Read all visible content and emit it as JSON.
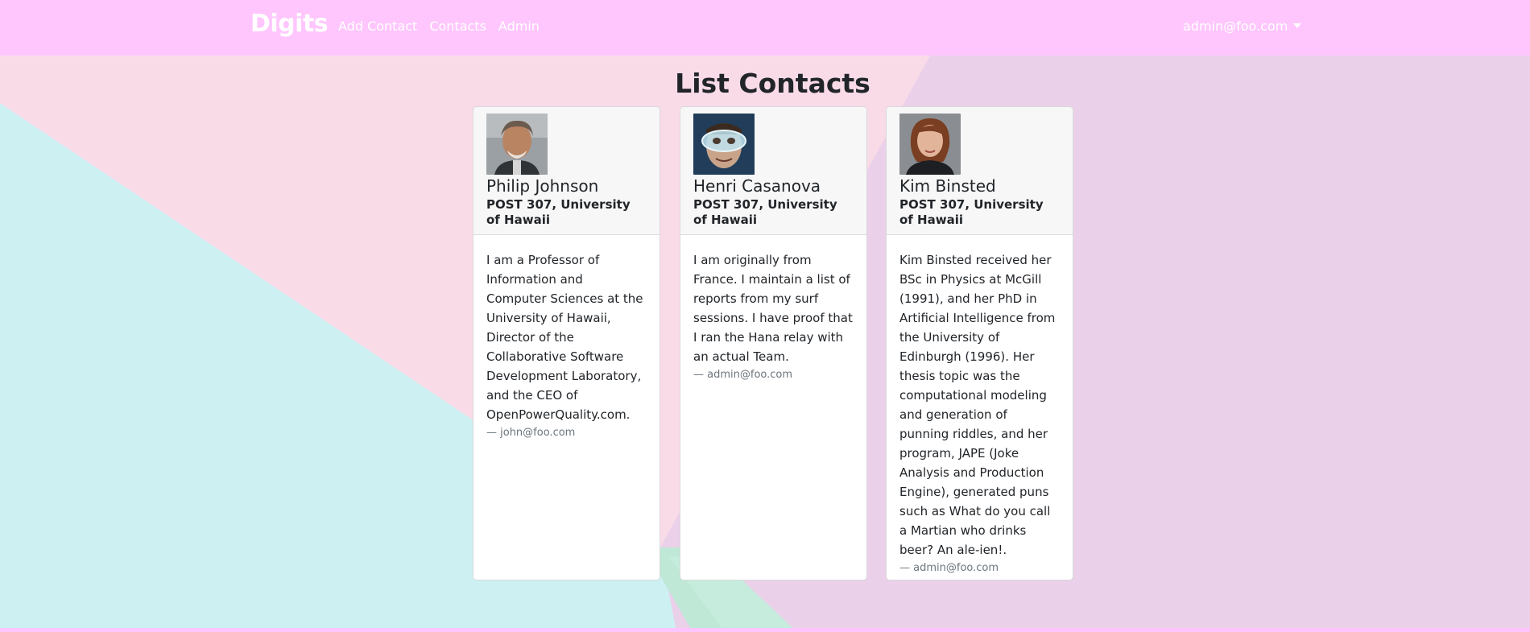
{
  "navbar": {
    "brand": "Digits",
    "links": [
      "Add Contact",
      "Contacts",
      "Admin"
    ],
    "user": "admin@foo.com"
  },
  "page": {
    "title": "List Contacts"
  },
  "contacts": [
    {
      "name": "Philip Johnson",
      "address": "POST 307, University of Hawaii",
      "description": "I am a Professor of Information and Computer Sciences at the University of Hawaii, Director of the Collaborative Software Development Laboratory, and the CEO of OpenPowerQuality.com.",
      "owner": "— john@foo.com"
    },
    {
      "name": "Henri Casanova",
      "address": "POST 307, University of Hawaii",
      "description": "I am originally from France. I maintain a list of reports from my surf sessions. I have proof that I ran the Hana relay with an actual Team.",
      "owner": "— admin@foo.com"
    },
    {
      "name": "Kim Binsted",
      "address": "POST 307, University of Hawaii",
      "description": "Kim Binsted received her BSc in Physics at McGill (1991), and her PhD in Artificial Intelligence from the University of Edinburgh (1996). Her thesis topic was the computational modeling and generation of punning riddles, and her program, JAPE (Joke Analysis and Production Engine), generated puns such as What do you call a Martian who drinks beer? An ale-ien!.",
      "owner": "— admin@foo.com"
    }
  ],
  "colors": {
    "navbar": "#ffc6fe",
    "bg_pink": "#f9dbe8",
    "bg_cyan": "#cdf0f3",
    "bg_lavender": "#ebd0ea",
    "bg_green": "#bfe8d6"
  }
}
